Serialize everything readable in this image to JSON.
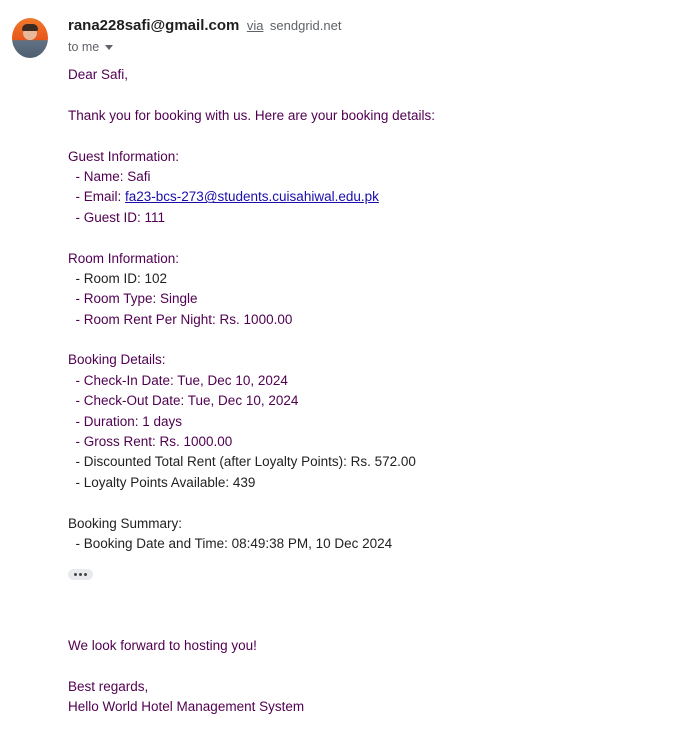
{
  "header": {
    "sender_email": "rana228safi@gmail.com",
    "via_label": "via",
    "via_domain": "sendgrid.net",
    "to_label": "to me"
  },
  "body": {
    "greeting": "Dear Safi,",
    "intro": "Thank you for booking with us. Here are your booking details:",
    "guest_heading": "Guest Information:",
    "guest_name": "  - Name: Safi",
    "guest_email_prefix": "  - Email: ",
    "guest_email_link": "fa23-bcs-273@students.cuisahiwal.edu.pk",
    "guest_id": "  - Guest ID: 111",
    "room_heading": "Room Information:",
    "room_id": "  - Room ID: 102",
    "room_type": "  - Room Type: Single",
    "room_rent": "  - Room Rent Per Night: Rs. 1000.00",
    "booking_heading": "Booking Details:",
    "check_in": "  - Check-In Date: Tue, Dec 10, 2024",
    "check_out": "  - Check-Out Date: Tue, Dec 10, 2024",
    "duration": "  - Duration: 1 days",
    "gross_rent": "  - Gross Rent: Rs. 1000.00",
    "discounted_rent": "  - Discounted Total Rent (after Loyalty Points): Rs. 572.00",
    "loyalty_points": "  - Loyalty Points Available: 439",
    "summary_heading": "Booking Summary:",
    "booking_time": "  - Booking Date and Time: 08:49:38 PM, 10 Dec 2024"
  },
  "footer": {
    "closing": "We look forward to hosting you!",
    "regards": "Best regards,",
    "signature": "Hello World Hotel Management System"
  },
  "icons": {
    "avatar": "sender-avatar",
    "dropdown": "chevron-down-icon",
    "ellipsis": "more-horiz-icon"
  },
  "colors": {
    "quoted_text": "#500050",
    "body_text": "#222222",
    "link": "#1a0dab"
  }
}
